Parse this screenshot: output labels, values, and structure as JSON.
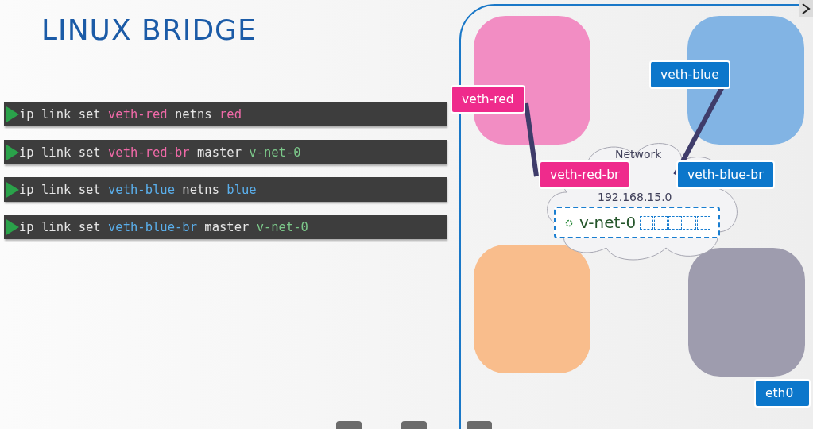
{
  "title": "LINUX BRIDGE",
  "commands": [
    {
      "tokens": [
        {
          "text": "ip link set ",
          "kind": "plain"
        },
        {
          "text": "veth-red",
          "kind": "red"
        },
        {
          "text": " netns ",
          "kind": "plain"
        },
        {
          "text": "red",
          "kind": "red"
        }
      ]
    },
    {
      "tokens": [
        {
          "text": "ip link set ",
          "kind": "plain"
        },
        {
          "text": "veth-red-br",
          "kind": "red"
        },
        {
          "text": " master ",
          "kind": "plain"
        },
        {
          "text": "v-net-0",
          "kind": "green"
        }
      ]
    },
    {
      "tokens": [
        {
          "text": "ip link set ",
          "kind": "plain"
        },
        {
          "text": "veth-blue",
          "kind": "blue"
        },
        {
          "text": " netns ",
          "kind": "plain"
        },
        {
          "text": "blue",
          "kind": "blue"
        }
      ]
    },
    {
      "tokens": [
        {
          "text": "ip link set ",
          "kind": "plain"
        },
        {
          "text": "veth-blue-br",
          "kind": "blue"
        },
        {
          "text": " master ",
          "kind": "plain"
        },
        {
          "text": "v-net-0",
          "kind": "green"
        }
      ]
    }
  ],
  "namespaces": [
    {
      "color": "#f28dc3"
    },
    {
      "color": "#82b4e4"
    },
    {
      "color": "#f9bd8c"
    },
    {
      "color": "#9e9cae"
    }
  ],
  "network": {
    "name": "Network",
    "subnet": "192.168.15.0",
    "bridge": "v-net-0"
  },
  "interfaces": [
    {
      "label": "veth-red",
      "color": "#ef2b8c"
    },
    {
      "label": "veth-blue",
      "color": "#0c77cb"
    },
    {
      "label": "veth-red-br",
      "color": "#ef2b8c"
    },
    {
      "label": "veth-blue-br",
      "color": "#0c77cb"
    },
    {
      "label": "eth0",
      "color": "#0c77cb"
    }
  ]
}
